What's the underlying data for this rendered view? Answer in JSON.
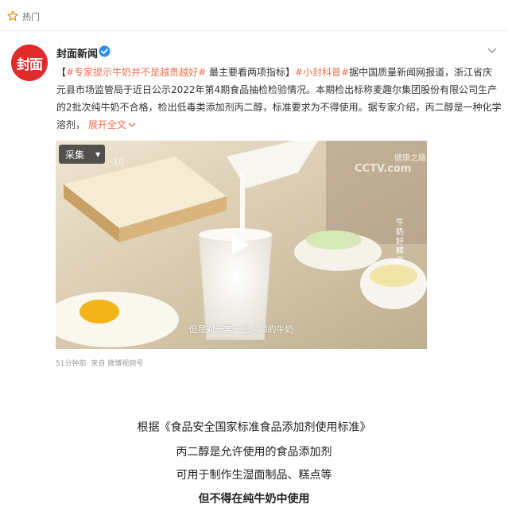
{
  "header": {
    "hot_label": "热门",
    "icon": "star-outline-icon"
  },
  "post": {
    "author": "封面新闻",
    "avatar_text": "封面",
    "verified_icon": "verified-badge-icon",
    "text": {
      "bracket_open": "【",
      "topic1": "#专家提示牛奶并不是越贵越好#",
      "headline": " 最主要看两项指标】",
      "topic2": "#小封科普#",
      "body": "据中国质量新闻网报道，浙江省庆元县市场监管局于近日公示2022年第4期食品抽检检验情况。本期检出标称麦趣尔集团股份有限公司生产的2批次纯牛奶不合格，检出低毒类添加剂丙二醇，标准要求为不得使用。据专家介绍，丙二醇是一种化学溶剂，",
      "expand": "展开全文"
    },
    "video": {
      "collect_label": "采集",
      "channel_tag": "健康之路",
      "cctv_logo": "CCTV.com",
      "vertical_tag": "牛奶好精选",
      "subtitle": "但是对于某一些人喝的牛奶",
      "watermark": "10"
    },
    "meta": {
      "time": "51分钟前",
      "source": "来自 微博视频号"
    }
  },
  "captions": [
    "根据《食品安全国家标准食品添加剂使用标准》",
    "丙二醇是允许使用的食品添加剂",
    "可用于制作生湿面制品、糕点等",
    "但不得在纯牛奶中使用"
  ],
  "colors": {
    "accent": "#eb7350",
    "brand_red": "#e12a2a",
    "verified_blue": "#2b8ee8"
  }
}
